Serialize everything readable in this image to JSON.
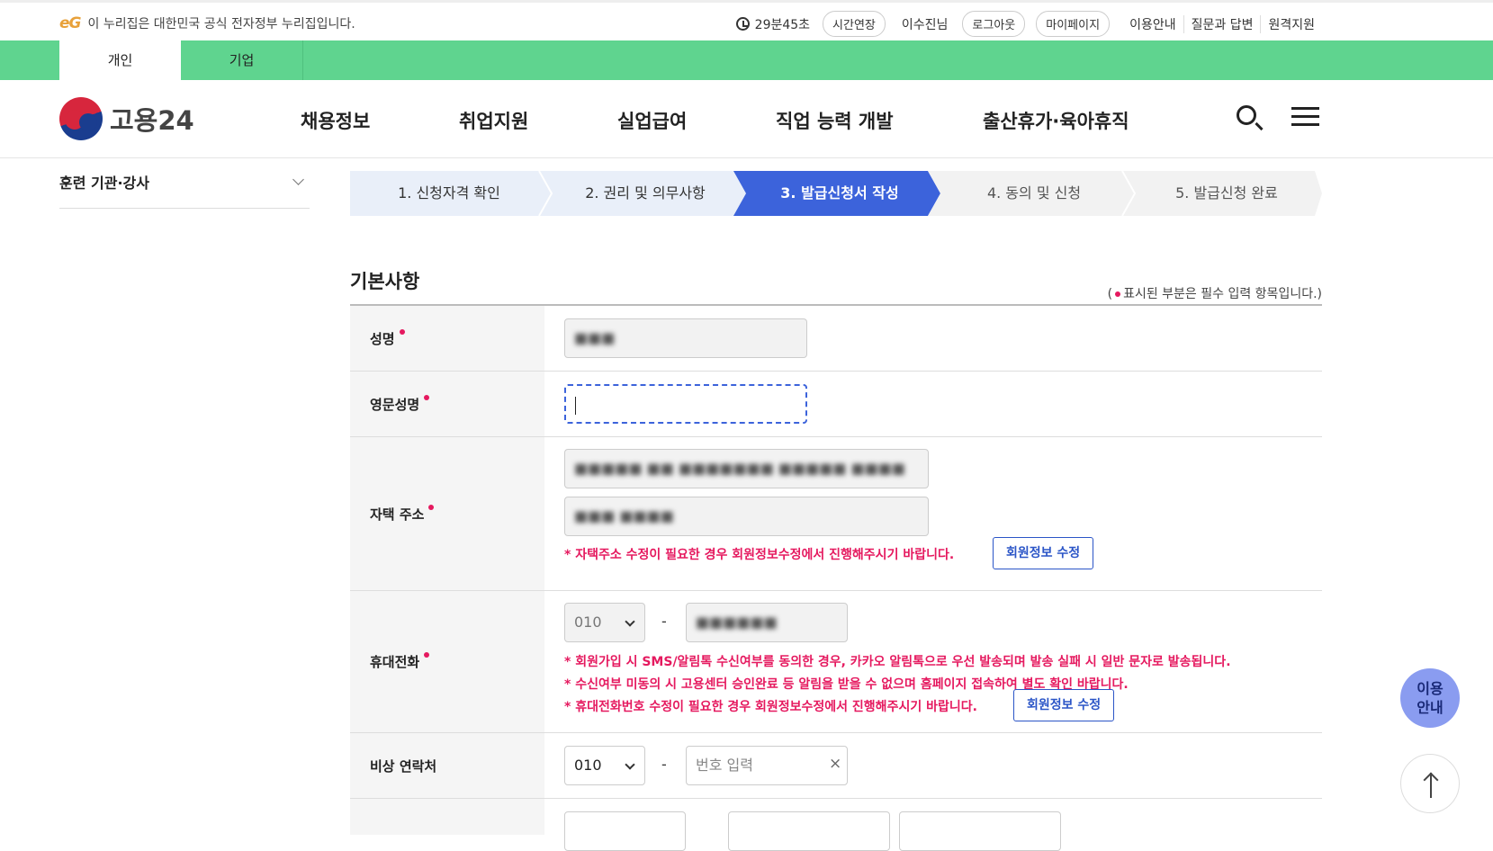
{
  "topbar": {
    "gov_badge": "eG",
    "gov_notice": "이 누리집은 대한민국 공식 전자정부 누리집입니다.",
    "timer": "29분45초",
    "extend_label": "시간연장",
    "user_name": "이수진님",
    "logout_label": "로그아웃",
    "mypage_label": "마이페이지",
    "links": [
      "이용안내",
      "질문과 답변",
      "원격지원"
    ]
  },
  "tabs": [
    "개인",
    "기업"
  ],
  "header": {
    "logo_text": "고용24",
    "nav": [
      "채용정보",
      "취업지원",
      "실업급여",
      "직업 능력 개발",
      "출산휴가·육아휴직"
    ]
  },
  "sidebar": {
    "title": "훈련 기관·강사"
  },
  "steps": [
    {
      "label": "1. 신청자격 확인",
      "state": "done"
    },
    {
      "label": "2. 권리 및 의무사항",
      "state": "done"
    },
    {
      "label": "3. 발급신청서 작성",
      "state": "current"
    },
    {
      "label": "4. 동의 및 신청",
      "state": "todo"
    },
    {
      "label": "5. 발급신청 완료",
      "state": "todo"
    }
  ],
  "colors": {
    "accent_green": "#5fd48f",
    "current_step": "#3c63db",
    "required": "#e5195f",
    "link_blue": "#2b55c7"
  },
  "form": {
    "section_title": "기본사항",
    "required_note_prefix": "(",
    "required_note_text": "표시된 부분은 필수 입력 항목입니다.)",
    "name": {
      "label": "성명",
      "value": "■■■"
    },
    "english_name": {
      "label": "영문성명",
      "value": ""
    },
    "address": {
      "label": "자택 주소",
      "line1": "■■■■■ ■■ ■■■■■■■ ■■■■■ ■■■■",
      "line2": "■■■ ■■■■",
      "warn": "* 자택주소 수정이 필요한 경우 회원정보수정에서 진행해주시기 바랍니다.",
      "edit_label": "회원정보 수정"
    },
    "mobile": {
      "label": "휴대전화",
      "prefix": "010",
      "dash": "-",
      "number": "■■■■■■",
      "warn1": "* 회원가입 시 SMS/알림톡 수신여부를 동의한 경우, 카카오 알림톡으로 우선 발송되며 발송 실패 시 일반 문자로 발송됩니다.",
      "warn2": "* 수신여부 미동의 시 고용센터 승인완료 등 알림을 받을 수 없으며 홈페이지 접속하여 별도 확인 바랍니다.",
      "warn3": "* 휴대전화번호 수정이 필요한 경우 회원정보수정에서 진행해주시기 바랍니다.",
      "edit_label": "회원정보 수정"
    },
    "emergency": {
      "label": "비상 연락처",
      "prefix": "010",
      "dash": "-",
      "placeholder": "번호 입력",
      "clear": "×"
    }
  },
  "floating": {
    "help_line1": "이용",
    "help_line2": "안내"
  }
}
